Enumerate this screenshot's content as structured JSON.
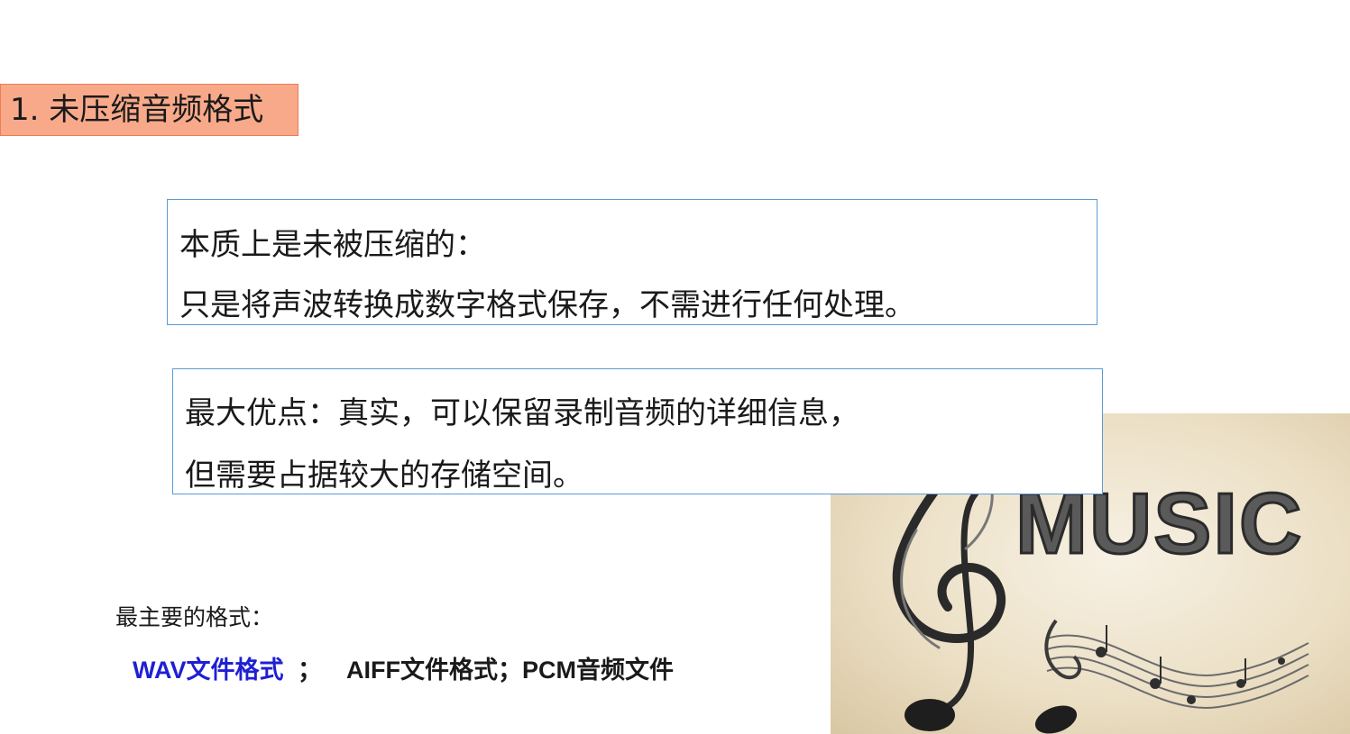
{
  "section": {
    "title": "1. 未压缩音频格式"
  },
  "box1": {
    "line1": "本质上是未被压缩的：",
    "line2": "只是将声波转换成数字格式保存，不需进行任何处理。"
  },
  "box2": {
    "line1": "最大优点：真实，可以保留录制音频的详细信息，",
    "line2": "但需要占据较大的存储空间。"
  },
  "formats": {
    "label": "最主要的格式：",
    "wav": "WAV文件格式",
    "wav_sep": "；",
    "rest": "AIFF文件格式；PCM音频文件",
    "wav_color": "#1f1fd4"
  },
  "image": {
    "word": "MUSIC",
    "icon": "treble-clef-music-notes"
  }
}
